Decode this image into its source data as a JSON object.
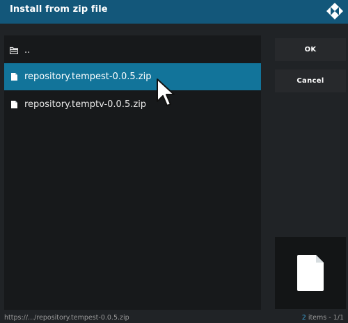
{
  "dialog": {
    "title": "Install from zip file"
  },
  "file_list": {
    "items": [
      {
        "label": "..",
        "icon": "folder-up-icon",
        "selected": false
      },
      {
        "label": "repository.tempest-0.0.5.zip",
        "icon": "file-icon",
        "selected": true
      },
      {
        "label": "repository.temptv-0.0.5.zip",
        "icon": "file-icon",
        "selected": false
      }
    ]
  },
  "buttons": {
    "ok_label": "OK",
    "cancel_label": "Cancel"
  },
  "preview": {
    "icon": "large-file-icon"
  },
  "status": {
    "path": "https://.../repository.tempest-0.0.5.zip",
    "item_count": "2",
    "items_suffix": " items - 1/1"
  },
  "colors": {
    "titlebar": "#13577a",
    "selection": "#12749a",
    "accent": "#3b9fd1"
  }
}
